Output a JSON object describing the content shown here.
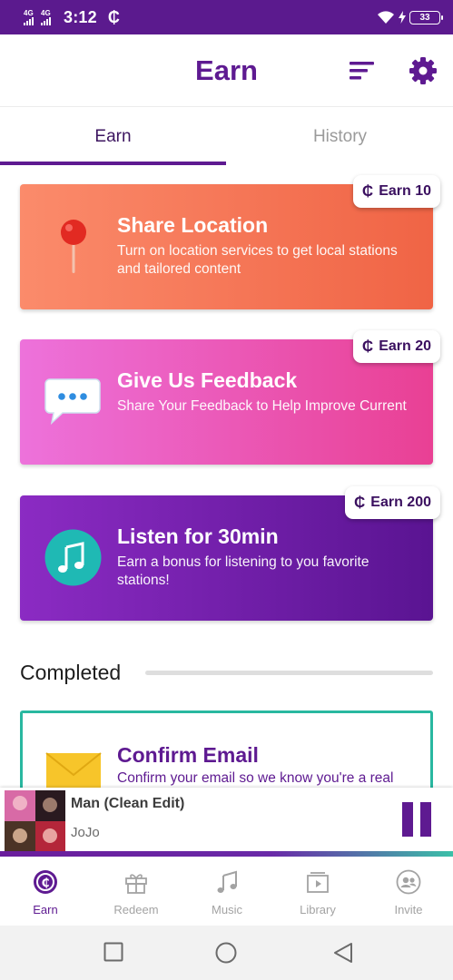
{
  "status_bar": {
    "signal_1": "4G",
    "signal_2": "4G",
    "time": "3:12",
    "coin_glyph": "₵",
    "battery": "33"
  },
  "app_bar": {
    "title": "Earn"
  },
  "tabs": [
    {
      "label": "Earn",
      "active": true
    },
    {
      "label": "History",
      "active": false
    }
  ],
  "cards": [
    {
      "title": "Share Location",
      "description": "Turn on location services to get local stations and tailored content",
      "badge": "Earn 10",
      "icon": "map-pin-icon"
    },
    {
      "title": "Give Us Feedback",
      "description": "Share Your Feedback to Help Improve Current",
      "badge": "Earn 20",
      "icon": "speech-bubble-icon"
    },
    {
      "title": "Listen for 30min",
      "description": "Earn a bonus for listening to you favorite stations!",
      "badge": "Earn 200",
      "icon": "music-note-icon"
    }
  ],
  "completed": {
    "heading": "Completed",
    "items": [
      {
        "title": "Confirm Email",
        "description": "Confirm your email so we know you're a real",
        "icon": "envelope-icon"
      }
    ]
  },
  "player": {
    "track": "Man (Clean Edit)",
    "artist": "JoJo",
    "state": "playing"
  },
  "bottom_nav": [
    {
      "label": "Earn",
      "icon": "coin-icon",
      "active": true
    },
    {
      "label": "Redeem",
      "icon": "gift-icon",
      "active": false
    },
    {
      "label": "Music",
      "icon": "music-icon",
      "active": false
    },
    {
      "label": "Library",
      "icon": "library-icon",
      "active": false
    },
    {
      "label": "Invite",
      "icon": "invite-icon",
      "active": false
    }
  ],
  "colors": {
    "brand": "#5e1a91",
    "status_bar": "#5b1a8e",
    "accent_teal": "#29b8a0"
  }
}
